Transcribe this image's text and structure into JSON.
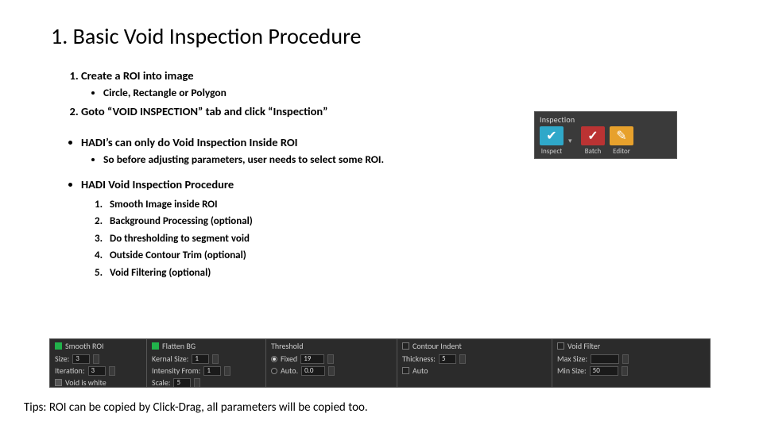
{
  "title": "1. Basic Void Inspection Procedure",
  "steps": {
    "s1": "Create a ROI into image",
    "s1a": "Circle, Rectangle or Polygon",
    "s2": "Goto “VOID INSPECTION” tab and click “Inspection”"
  },
  "notes": {
    "n1": "HADI’s can only do Void Inspection Inside ROI",
    "n1a": "So before adjusting parameters, user needs to select some ROI.",
    "n2": "HADI Void Inspection Procedure"
  },
  "procedure": {
    "p1": "Smooth Image inside ROI",
    "p2": "Background Processing (optional)",
    "p3": "Do thresholding to segment void",
    "p4": "Outside Contour Trim (optional)",
    "p5": "Void Filtering (optional)"
  },
  "tips": "Tips: ROI can be copied by Click-Drag, all parameters will be copied too.",
  "inspection_panel": {
    "header": "Inspection",
    "inspect": "Inspect",
    "batch": "Batch",
    "editor": "Editor",
    "dd": "▾"
  },
  "param_bar": {
    "smooth": {
      "header": "Smooth ROI",
      "size_lbl": "Size:",
      "size_val": "3",
      "iter_lbl": "Iteration:",
      "iter_val": "3",
      "void_white": "Void is white"
    },
    "flatten": {
      "header": "Flatten BG",
      "ksize_lbl": "Kernal Size:",
      "ksize_val": "1",
      "inten_lbl": "Intensity From:",
      "inten_val": "1",
      "scale_lbl": "Scale:",
      "scale_val": "5"
    },
    "threshold": {
      "header": "Threshold",
      "fixed_lbl": "Fixed",
      "fixed_val": "19",
      "auto_lbl": "Auto.",
      "auto_val": "0.0"
    },
    "contour": {
      "header": "Contour Indent",
      "thick_lbl": "Thickness:",
      "thick_val": "5",
      "auto_lbl": "Auto"
    },
    "voidfilter": {
      "header": "Void Filter",
      "max_lbl": "Max Size:",
      "min_lbl": "Min Size:",
      "min_val": "50"
    }
  }
}
